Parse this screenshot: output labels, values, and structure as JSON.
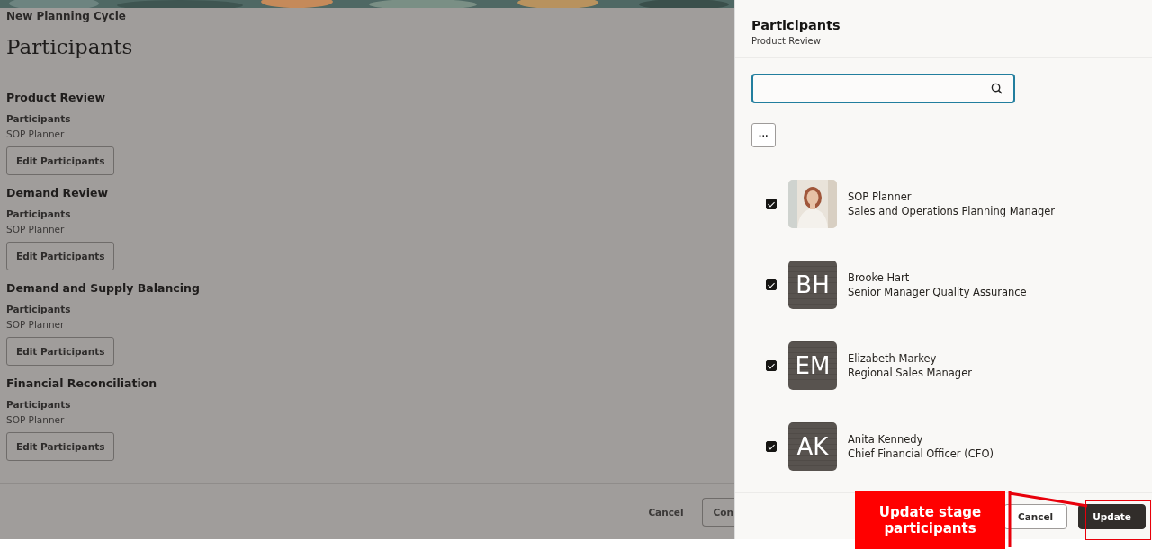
{
  "page": {
    "breadcrumb": "New Planning Cycle",
    "title": "Participants",
    "stages": [
      {
        "name": "Product Review",
        "label": "Participants",
        "value": "SOP Planner",
        "button": "Edit Participants"
      },
      {
        "name": "Demand Review",
        "label": "Participants",
        "value": "SOP Planner",
        "button": "Edit Participants"
      },
      {
        "name": "Demand and Supply Balancing",
        "label": "Participants",
        "value": "SOP Planner",
        "button": "Edit Participants"
      },
      {
        "name": "Financial Reconciliation",
        "label": "Participants",
        "value": "SOP Planner",
        "button": "Edit Participants"
      }
    ],
    "footer_buttons": [
      "Cancel",
      "Con"
    ]
  },
  "drawer": {
    "title": "Participants",
    "subtitle": "Product Review",
    "search": {
      "kind": "search"
    },
    "more_button": "···",
    "participants": [
      {
        "name": "SOP Planner",
        "role": "Sales and Operations Planning Manager",
        "checked": true
      },
      {
        "kind": "initials",
        "initials": "BH",
        "name": "Brooke Hart",
        "role": "Senior Manager Quality Assurance",
        "checked": true
      },
      {
        "kind": "initials",
        "initials": "EM",
        "name": "Elizabeth Markey",
        "role": "Regional Sales Manager",
        "checked": true
      },
      {
        "kind": "initials",
        "initials": "AK",
        "name": "Anita Kennedy",
        "role": "Chief Financial Officer (CFO)",
        "checked": true
      }
    ],
    "buttons": [
      {
        "label": "Cancel",
        "primary": false
      },
      {
        "label": "Update",
        "primary": true
      }
    ]
  },
  "callout": {
    "text": "Update stage participants"
  }
}
